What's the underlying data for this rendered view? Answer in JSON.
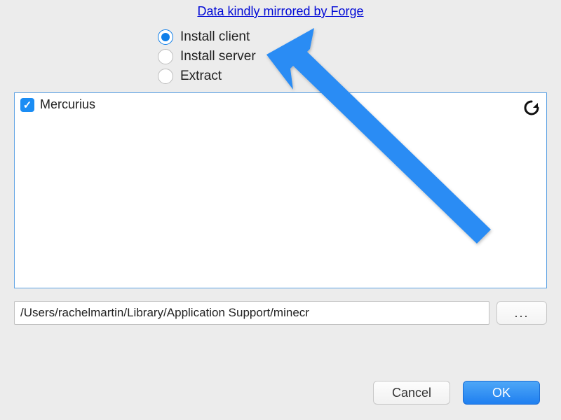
{
  "header": {
    "link_text": "Data kindly mirrored by Forge"
  },
  "radios": {
    "install_client": "Install client",
    "install_server": "Install server",
    "extract": "Extract",
    "selected": "install_client"
  },
  "list": {
    "items": [
      {
        "label": "Mercurius",
        "checked": true
      }
    ]
  },
  "path": {
    "value": "/Users/rachelmartin/Library/Application Support/minecr",
    "browse_label": "..."
  },
  "buttons": {
    "cancel": "Cancel",
    "ok": "OK"
  },
  "colors": {
    "accent": "#1f7ff0",
    "link": "#0008d6",
    "panel_border": "#5ea3e4",
    "arrow": "#2a8cf4"
  }
}
